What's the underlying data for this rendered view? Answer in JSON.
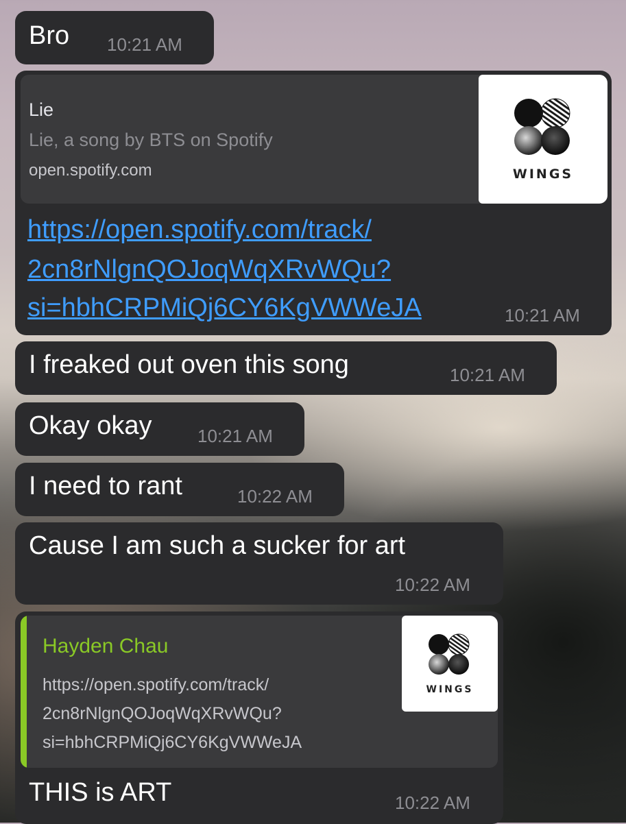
{
  "messages": {
    "bro": {
      "text": "Bro",
      "time": "10:21 AM"
    },
    "link_message": {
      "preview": {
        "title": "Lie",
        "description": "Lie, a song by BTS on Spotify",
        "domain": "open.spotify.com",
        "thumbnail_text": "WINGS"
      },
      "url_lines": [
        "https://open.spotify.com/track/",
        "2cn8rNlgnQOJoqWqXRvWQu?",
        "si=hbhCRPMiQj6CY6KgVWWeJA"
      ],
      "time": "10:21 AM"
    },
    "freaked": {
      "text": "I freaked out oven this song",
      "time": "10:21 AM"
    },
    "okay": {
      "text": "Okay okay",
      "time": "10:21 AM"
    },
    "rant": {
      "text": "I need to rant",
      "time": "10:22 AM"
    },
    "sucker": {
      "text": "Cause I am such a sucker for art",
      "time": "10:22 AM"
    },
    "art_reply": {
      "quote": {
        "author": "Hayden Chau",
        "lines": [
          "https://open.spotify.com/track/",
          "2cn8rNlgnQOJoqWqXRvWQu?",
          "si=hbhCRPMiQj6CY6KgVWWeJA"
        ],
        "thumbnail_text": "WINGS"
      },
      "text": "THIS is ART",
      "time": "10:22 AM"
    }
  },
  "colors": {
    "bubble": "#2b2b2d",
    "link": "#3f9dff",
    "reply_accent": "#8ac926",
    "timestamp": "#8e8e93"
  }
}
